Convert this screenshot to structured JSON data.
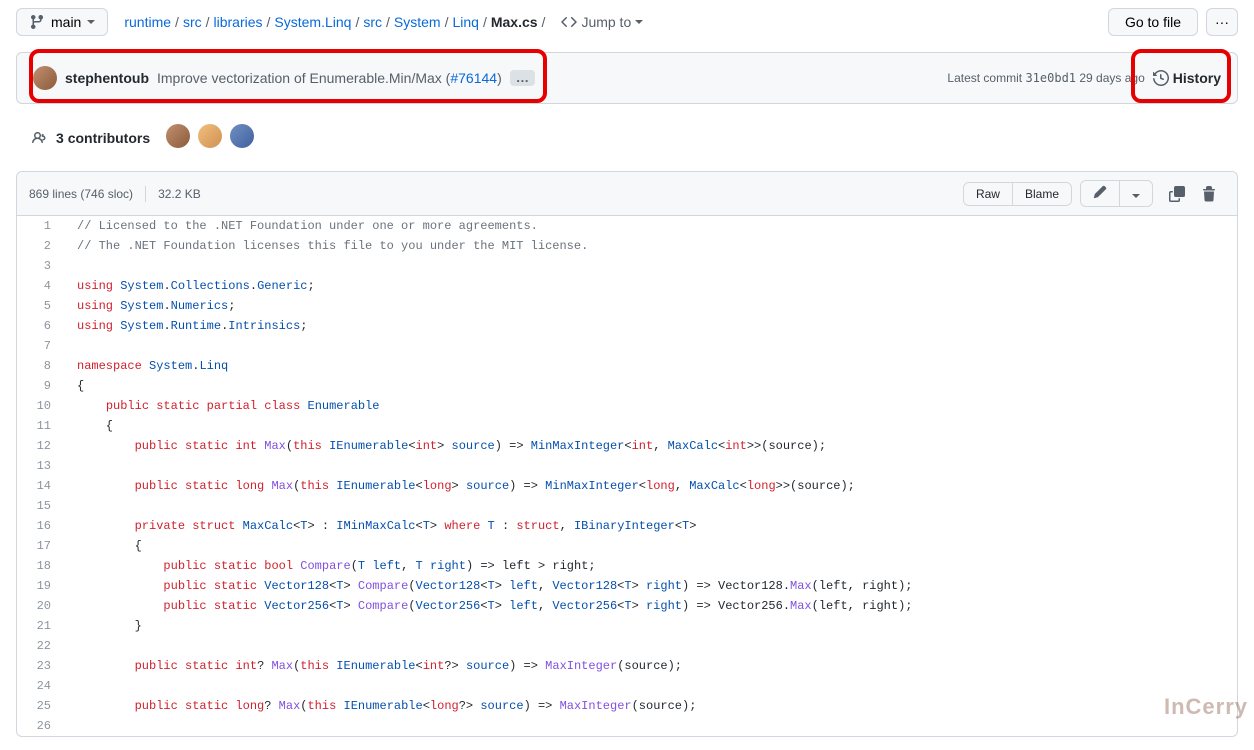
{
  "branch": "main",
  "breadcrumb": [
    "runtime",
    "src",
    "libraries",
    "System.Linq",
    "src",
    "System",
    "Linq"
  ],
  "current_file": "Max.cs",
  "jump_to": "Jump to",
  "go_to_file": "Go to file",
  "commit": {
    "author": "stephentoub",
    "message_pre": "Improve vectorization of Enumerable.Min/Max (",
    "pr": "#76144",
    "message_post": ")",
    "latest_label": "Latest commit",
    "sha": "31e0bd1",
    "age": "29 days ago",
    "history": "History"
  },
  "contributors": {
    "count": "3",
    "label": "contributors"
  },
  "file_stats": {
    "lines": "869 lines (746 sloc)",
    "size": "32.2 KB"
  },
  "buttons": {
    "raw": "Raw",
    "blame": "Blame"
  },
  "code_lines": [
    {
      "n": 1,
      "segs": [
        [
          "c-comment",
          "// Licensed to the .NET Foundation under one or more agreements."
        ]
      ]
    },
    {
      "n": 2,
      "segs": [
        [
          "c-comment",
          "// The .NET Foundation licenses this file to you under the MIT license."
        ]
      ]
    },
    {
      "n": 3,
      "segs": []
    },
    {
      "n": 4,
      "segs": [
        [
          "c-keyword",
          "using"
        ],
        [
          "",
          " "
        ],
        [
          "c-type",
          "System"
        ],
        [
          "",
          "."
        ],
        [
          "c-type",
          "Collections"
        ],
        [
          "",
          "."
        ],
        [
          "c-type",
          "Generic"
        ],
        [
          "",
          ";"
        ]
      ]
    },
    {
      "n": 5,
      "segs": [
        [
          "c-keyword",
          "using"
        ],
        [
          "",
          " "
        ],
        [
          "c-type",
          "System"
        ],
        [
          "",
          "."
        ],
        [
          "c-type",
          "Numerics"
        ],
        [
          "",
          ";"
        ]
      ]
    },
    {
      "n": 6,
      "segs": [
        [
          "c-keyword",
          "using"
        ],
        [
          "",
          " "
        ],
        [
          "c-type",
          "System"
        ],
        [
          "",
          "."
        ],
        [
          "c-type",
          "Runtime"
        ],
        [
          "",
          "."
        ],
        [
          "c-type",
          "Intrinsics"
        ],
        [
          "",
          ";"
        ]
      ]
    },
    {
      "n": 7,
      "segs": []
    },
    {
      "n": 8,
      "segs": [
        [
          "c-keyword",
          "namespace"
        ],
        [
          "",
          " "
        ],
        [
          "c-type",
          "System"
        ],
        [
          "",
          "."
        ],
        [
          "c-type",
          "Linq"
        ]
      ]
    },
    {
      "n": 9,
      "segs": [
        [
          "",
          "{"
        ]
      ]
    },
    {
      "n": 10,
      "segs": [
        [
          "",
          "    "
        ],
        [
          "c-keyword",
          "public"
        ],
        [
          "",
          " "
        ],
        [
          "c-keyword",
          "static"
        ],
        [
          "",
          " "
        ],
        [
          "c-keyword",
          "partial"
        ],
        [
          "",
          " "
        ],
        [
          "c-keyword",
          "class"
        ],
        [
          "",
          " "
        ],
        [
          "c-type",
          "Enumerable"
        ]
      ]
    },
    {
      "n": 11,
      "segs": [
        [
          "",
          "    {"
        ]
      ]
    },
    {
      "n": 12,
      "segs": [
        [
          "",
          "        "
        ],
        [
          "c-keyword",
          "public"
        ],
        [
          "",
          " "
        ],
        [
          "c-keyword",
          "static"
        ],
        [
          "",
          " "
        ],
        [
          "c-keyword",
          "int"
        ],
        [
          "",
          " "
        ],
        [
          "c-method",
          "Max"
        ],
        [
          "",
          "("
        ],
        [
          "c-keyword",
          "this"
        ],
        [
          "",
          " "
        ],
        [
          "c-type",
          "IEnumerable"
        ],
        [
          "",
          "<"
        ],
        [
          "c-keyword",
          "int"
        ],
        [
          "",
          "> "
        ],
        [
          "c-type",
          "source"
        ],
        [
          "",
          ") => "
        ],
        [
          "c-type",
          "MinMaxInteger"
        ],
        [
          "",
          "<"
        ],
        [
          "c-keyword",
          "int"
        ],
        [
          "",
          ", "
        ],
        [
          "c-type",
          "MaxCalc"
        ],
        [
          "",
          "<"
        ],
        [
          "c-keyword",
          "int"
        ],
        [
          "",
          ">>("
        ],
        [
          "",
          "source"
        ],
        [
          "",
          ");"
        ]
      ]
    },
    {
      "n": 13,
      "segs": []
    },
    {
      "n": 14,
      "segs": [
        [
          "",
          "        "
        ],
        [
          "c-keyword",
          "public"
        ],
        [
          "",
          " "
        ],
        [
          "c-keyword",
          "static"
        ],
        [
          "",
          " "
        ],
        [
          "c-keyword",
          "long"
        ],
        [
          "",
          " "
        ],
        [
          "c-method",
          "Max"
        ],
        [
          "",
          "("
        ],
        [
          "c-keyword",
          "this"
        ],
        [
          "",
          " "
        ],
        [
          "c-type",
          "IEnumerable"
        ],
        [
          "",
          "<"
        ],
        [
          "c-keyword",
          "long"
        ],
        [
          "",
          "> "
        ],
        [
          "c-type",
          "source"
        ],
        [
          "",
          ") => "
        ],
        [
          "c-type",
          "MinMaxInteger"
        ],
        [
          "",
          "<"
        ],
        [
          "c-keyword",
          "long"
        ],
        [
          "",
          ", "
        ],
        [
          "c-type",
          "MaxCalc"
        ],
        [
          "",
          "<"
        ],
        [
          "c-keyword",
          "long"
        ],
        [
          "",
          ">>("
        ],
        [
          "",
          "source"
        ],
        [
          "",
          ");"
        ]
      ]
    },
    {
      "n": 15,
      "segs": []
    },
    {
      "n": 16,
      "segs": [
        [
          "",
          "        "
        ],
        [
          "c-keyword",
          "private"
        ],
        [
          "",
          " "
        ],
        [
          "c-keyword",
          "struct"
        ],
        [
          "",
          " "
        ],
        [
          "c-type",
          "MaxCalc"
        ],
        [
          "",
          "<"
        ],
        [
          "c-type",
          "T"
        ],
        [
          "",
          "> : "
        ],
        [
          "c-type",
          "IMinMaxCalc"
        ],
        [
          "",
          "<"
        ],
        [
          "c-type",
          "T"
        ],
        [
          "",
          "> "
        ],
        [
          "c-keyword",
          "where"
        ],
        [
          "",
          " "
        ],
        [
          "c-type",
          "T"
        ],
        [
          "",
          " : "
        ],
        [
          "c-keyword",
          "struct"
        ],
        [
          "",
          ", "
        ],
        [
          "c-type",
          "IBinaryInteger"
        ],
        [
          "",
          "<"
        ],
        [
          "c-type",
          "T"
        ],
        [
          "",
          ">"
        ]
      ]
    },
    {
      "n": 17,
      "segs": [
        [
          "",
          "        {"
        ]
      ]
    },
    {
      "n": 18,
      "segs": [
        [
          "",
          "            "
        ],
        [
          "c-keyword",
          "public"
        ],
        [
          "",
          " "
        ],
        [
          "c-keyword",
          "static"
        ],
        [
          "",
          " "
        ],
        [
          "c-keyword",
          "bool"
        ],
        [
          "",
          " "
        ],
        [
          "c-method",
          "Compare"
        ],
        [
          "",
          "("
        ],
        [
          "c-type",
          "T"
        ],
        [
          "",
          " "
        ],
        [
          "c-type",
          "left"
        ],
        [
          "",
          ", "
        ],
        [
          "c-type",
          "T"
        ],
        [
          "",
          " "
        ],
        [
          "c-type",
          "right"
        ],
        [
          "",
          ") => "
        ],
        [
          "",
          "left"
        ],
        [
          "",
          " > "
        ],
        [
          "",
          "right"
        ],
        [
          "",
          ";"
        ]
      ]
    },
    {
      "n": 19,
      "segs": [
        [
          "",
          "            "
        ],
        [
          "c-keyword",
          "public"
        ],
        [
          "",
          " "
        ],
        [
          "c-keyword",
          "static"
        ],
        [
          "",
          " "
        ],
        [
          "c-type",
          "Vector128"
        ],
        [
          "",
          "<"
        ],
        [
          "c-type",
          "T"
        ],
        [
          "",
          "> "
        ],
        [
          "c-method",
          "Compare"
        ],
        [
          "",
          "("
        ],
        [
          "c-type",
          "Vector128"
        ],
        [
          "",
          "<"
        ],
        [
          "c-type",
          "T"
        ],
        [
          "",
          "> "
        ],
        [
          "c-type",
          "left"
        ],
        [
          "",
          ", "
        ],
        [
          "c-type",
          "Vector128"
        ],
        [
          "",
          "<"
        ],
        [
          "c-type",
          "T"
        ],
        [
          "",
          "> "
        ],
        [
          "c-type",
          "right"
        ],
        [
          "",
          ") => "
        ],
        [
          "",
          "Vector128"
        ],
        [
          "",
          "."
        ],
        [
          "c-method",
          "Max"
        ],
        [
          "",
          "("
        ],
        [
          "",
          "left"
        ],
        [
          "",
          ", "
        ],
        [
          "",
          "right"
        ],
        [
          "",
          ");"
        ]
      ]
    },
    {
      "n": 20,
      "segs": [
        [
          "",
          "            "
        ],
        [
          "c-keyword",
          "public"
        ],
        [
          "",
          " "
        ],
        [
          "c-keyword",
          "static"
        ],
        [
          "",
          " "
        ],
        [
          "c-type",
          "Vector256"
        ],
        [
          "",
          "<"
        ],
        [
          "c-type",
          "T"
        ],
        [
          "",
          "> "
        ],
        [
          "c-method",
          "Compare"
        ],
        [
          "",
          "("
        ],
        [
          "c-type",
          "Vector256"
        ],
        [
          "",
          "<"
        ],
        [
          "c-type",
          "T"
        ],
        [
          "",
          "> "
        ],
        [
          "c-type",
          "left"
        ],
        [
          "",
          ", "
        ],
        [
          "c-type",
          "Vector256"
        ],
        [
          "",
          "<"
        ],
        [
          "c-type",
          "T"
        ],
        [
          "",
          "> "
        ],
        [
          "c-type",
          "right"
        ],
        [
          "",
          ") => "
        ],
        [
          "",
          "Vector256"
        ],
        [
          "",
          "."
        ],
        [
          "c-method",
          "Max"
        ],
        [
          "",
          "("
        ],
        [
          "",
          "left"
        ],
        [
          "",
          ", "
        ],
        [
          "",
          "right"
        ],
        [
          "",
          ");"
        ]
      ]
    },
    {
      "n": 21,
      "segs": [
        [
          "",
          "        }"
        ]
      ]
    },
    {
      "n": 22,
      "segs": []
    },
    {
      "n": 23,
      "segs": [
        [
          "",
          "        "
        ],
        [
          "c-keyword",
          "public"
        ],
        [
          "",
          " "
        ],
        [
          "c-keyword",
          "static"
        ],
        [
          "",
          " "
        ],
        [
          "c-keyword",
          "int"
        ],
        [
          "",
          "? "
        ],
        [
          "c-method",
          "Max"
        ],
        [
          "",
          "("
        ],
        [
          "c-keyword",
          "this"
        ],
        [
          "",
          " "
        ],
        [
          "c-type",
          "IEnumerable"
        ],
        [
          "",
          "<"
        ],
        [
          "c-keyword",
          "int"
        ],
        [
          "",
          "?> "
        ],
        [
          "c-type",
          "source"
        ],
        [
          "",
          ") => "
        ],
        [
          "c-method",
          "MaxInteger"
        ],
        [
          "",
          "("
        ],
        [
          "",
          "source"
        ],
        [
          "",
          ");"
        ]
      ]
    },
    {
      "n": 24,
      "segs": []
    },
    {
      "n": 25,
      "segs": [
        [
          "",
          "        "
        ],
        [
          "c-keyword",
          "public"
        ],
        [
          "",
          " "
        ],
        [
          "c-keyword",
          "static"
        ],
        [
          "",
          " "
        ],
        [
          "c-keyword",
          "long"
        ],
        [
          "",
          "? "
        ],
        [
          "c-method",
          "Max"
        ],
        [
          "",
          "("
        ],
        [
          "c-keyword",
          "this"
        ],
        [
          "",
          " "
        ],
        [
          "c-type",
          "IEnumerable"
        ],
        [
          "",
          "<"
        ],
        [
          "c-keyword",
          "long"
        ],
        [
          "",
          "?> "
        ],
        [
          "c-type",
          "source"
        ],
        [
          "",
          ") => "
        ],
        [
          "c-method",
          "MaxInteger"
        ],
        [
          "",
          "("
        ],
        [
          "",
          "source"
        ],
        [
          "",
          ");"
        ]
      ]
    },
    {
      "n": 26,
      "segs": []
    }
  ],
  "watermark": "InCerry"
}
